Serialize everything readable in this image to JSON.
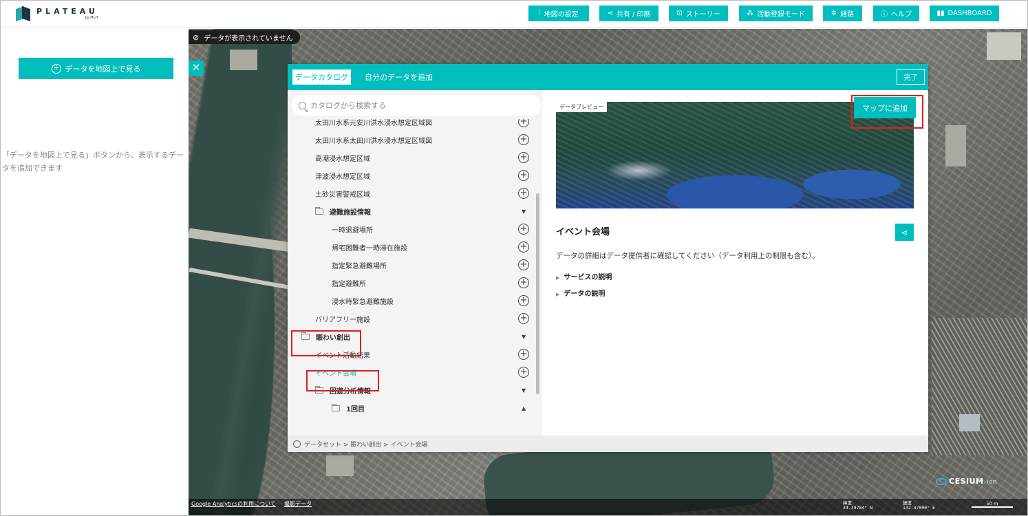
{
  "logo": {
    "name": "PLATEAU",
    "sub": "by MLIT"
  },
  "header_buttons": [
    {
      "icon": "sliders-icon",
      "label": "地図の設定"
    },
    {
      "icon": "share-icon",
      "label": "共有 / 印刷"
    },
    {
      "icon": "story-icon",
      "label": "ストーリー"
    },
    {
      "icon": "people-icon",
      "label": "活動登録モード"
    },
    {
      "icon": "route-icon",
      "label": "経路"
    },
    {
      "icon": "help-icon",
      "label": "ヘルプ"
    },
    {
      "icon": "book-icon",
      "label": "DASHBOARD"
    }
  ],
  "sidebar": {
    "add_button": "データを地図上で見る",
    "hint": "「データを地図上で見る」ボタンから、表示するデータを追加できます"
  },
  "map": {
    "no_data_badge": "データが表示されていません",
    "footer_link_1": "Google Analyticsの利用について",
    "footer_link_2": "撮影データ",
    "lat_label": "緯度",
    "lat_value": "34.39784° N",
    "lon_label": "経度",
    "lon_value": "132.47000° E",
    "scale_label": "50 m",
    "cesium_label": "CESIUM",
    "cesium_suffix": "ion"
  },
  "modal": {
    "tabs": [
      "データカタログ",
      "自分のデータを追加"
    ],
    "done_button": "完了",
    "search_placeholder": "カタログから検索する",
    "tree": [
      {
        "label": "太田川水系元安川洪水浸水想定区域図",
        "type": "item",
        "indent": 1
      },
      {
        "label": "太田川水系太田川洪水浸水想定区域図",
        "type": "item",
        "indent": 1
      },
      {
        "label": "高潮浸水想定区域",
        "type": "item",
        "indent": 1
      },
      {
        "label": "津波浸水想定区域",
        "type": "item",
        "indent": 1
      },
      {
        "label": "土砂災害警戒区域",
        "type": "item",
        "indent": 1
      },
      {
        "label": "避難施設情報",
        "type": "folder",
        "indent": 1,
        "caret": "▼"
      },
      {
        "label": "一時退避場所",
        "type": "item",
        "indent": 2
      },
      {
        "label": "帰宅困難者一時滞在施設",
        "type": "item",
        "indent": 2
      },
      {
        "label": "指定緊急避難場所",
        "type": "item",
        "indent": 2
      },
      {
        "label": "指定避難所",
        "type": "item",
        "indent": 2
      },
      {
        "label": "浸水時緊急避難施設",
        "type": "item",
        "indent": 2
      },
      {
        "label": "バリアフリー施設",
        "type": "item",
        "indent": 1
      },
      {
        "label": "賑わい創出",
        "type": "folder",
        "indent": 0,
        "caret": "▼"
      },
      {
        "label": "イベント活動結果",
        "type": "item",
        "indent": 1
      },
      {
        "label": "イベント会場",
        "type": "item",
        "indent": 1,
        "active": true
      },
      {
        "label": "回遊分析情報",
        "type": "folder",
        "indent": 1,
        "caret": "▼"
      },
      {
        "label": "1回目",
        "type": "folder",
        "indent": 2,
        "caret": "▲"
      }
    ],
    "breadcrumb": "データセット > 賑わい創出 > イベント会場",
    "preview_label": "データプレビュー",
    "add_to_map_button": "マップに追加",
    "item_title": "イベント会場",
    "description": "データの詳細はデータ提供者に確認してください（データ利用上の制限も含む）。",
    "accordions": [
      "サービスの説明",
      "データの説明"
    ]
  },
  "colors": {
    "accent": "#00bebe",
    "highlight": "#e01e1e"
  }
}
